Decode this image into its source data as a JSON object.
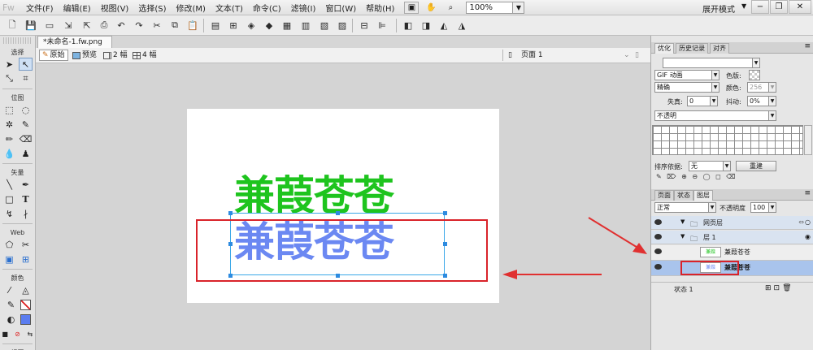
{
  "app": {
    "logo": "Fw"
  },
  "menus": [
    "文件(F)",
    "编辑(E)",
    "视图(V)",
    "选择(S)",
    "修改(M)",
    "文本(T)",
    "命令(C)",
    "滤镜(I)",
    "窗口(W)",
    "帮助(H)"
  ],
  "zoom": "100%",
  "workspace_mode": "展开模式",
  "window_controls": [
    "−",
    "❐",
    "✕"
  ],
  "document": {
    "tab_title": "*未命名-1.fw.png",
    "views": [
      "原始",
      "预览",
      "2 幅",
      "4 幅"
    ],
    "page_label": "页面 1"
  },
  "tools": {
    "sections": [
      "选择",
      "位图",
      "矢量",
      "Web",
      "颜色",
      "视图"
    ]
  },
  "canvas": {
    "text_top": "兼葭苍苍",
    "text_bottom": "兼葭苍苍",
    "text_top_color": "#1ec41e",
    "text_bottom_color": "#6b88f2",
    "highlight_color": "#d9232a"
  },
  "optimize_panel": {
    "tabs": [
      "优化",
      "历史记录",
      "对齐"
    ],
    "format": "GIF 动画",
    "matte_label": "色版:",
    "palette": "精确",
    "colors_label": "颜色:",
    "colors_value": "256",
    "loss_label": "失真:",
    "loss_value": "0",
    "dither_label": "抖动:",
    "dither_value": "0%",
    "transparency": "不透明",
    "sort_label": "排序依据:",
    "sort_value": "无",
    "rebuild_button": "重建"
  },
  "layers_panel": {
    "tabs": [
      "页面",
      "状态",
      "图层"
    ],
    "blend_mode": "正常",
    "opacity_label": "不透明度",
    "opacity_value": "100",
    "layers": [
      {
        "name": "网页层"
      },
      {
        "name": "层 1"
      },
      {
        "name": "兼葭苍苍"
      },
      {
        "name": "兼葭苍苍"
      }
    ],
    "footer_status": "状态 1"
  }
}
